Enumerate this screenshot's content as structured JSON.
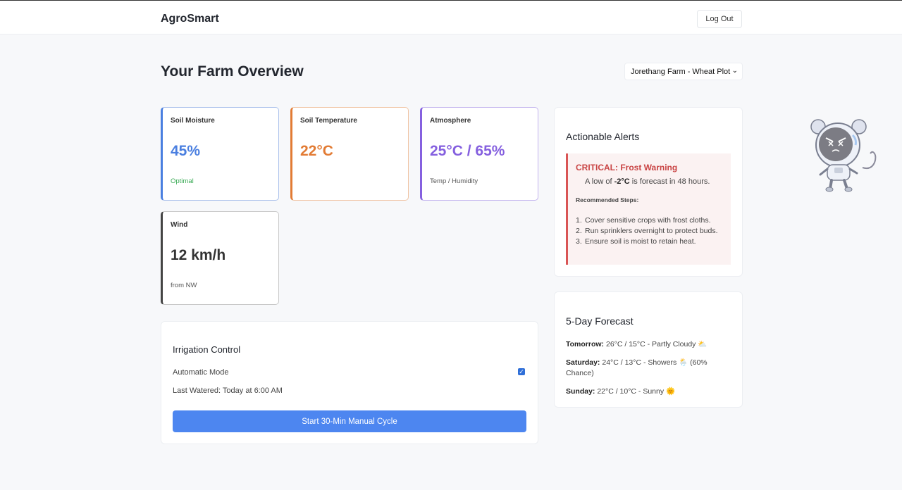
{
  "app": {
    "brand": "AgroSmart",
    "logout_label": "Log Out"
  },
  "page": {
    "title": "Your Farm Overview",
    "farm_selector": "Jorethang Farm - Wheat Plot"
  },
  "metrics": [
    {
      "label": "Soil Moisture",
      "value": "45%",
      "sub": "Optimal",
      "accent": "#4a7fe0"
    },
    {
      "label": "Soil Temperature",
      "value": "22°C",
      "sub": "",
      "accent": "#e27b34"
    },
    {
      "label": "Atmosphere",
      "value": "25°C / 65%",
      "sub": "Temp / Humidity",
      "accent": "#8560df"
    },
    {
      "label": "Wind",
      "value": "12 km/h",
      "sub": "from NW",
      "accent": "#444444"
    }
  ],
  "irrigation": {
    "title": "Irrigation Control",
    "auto_mode_label": "Automatic Mode",
    "auto_mode_checked": true,
    "last_watered": "Last Watered: Today at 6:00 AM",
    "manual_button": "Start 30-Min Manual Cycle"
  },
  "alerts": {
    "title": "Actionable Alerts",
    "alert_title": "CRITICAL: Frost Warning",
    "desc_prefix": "A low of ",
    "desc_value": "-2°C",
    "desc_suffix": " is forecast in 48 hours.",
    "steps_label": "Recommended Steps:",
    "steps": [
      {
        "num": "1.",
        "text": "Cover sensitive crops with frost cloths."
      },
      {
        "num": "2.",
        "text": "Run sprinklers overnight to protect buds."
      },
      {
        "num": "3.",
        "text": "Ensure soil is moist to retain heat."
      }
    ],
    "color": "#d95555"
  },
  "forecast": {
    "title": "5-Day Forecast",
    "days": [
      {
        "day": "Tomorrow:",
        "text": " 26°C / 15°C - Partly Cloudy ⛅"
      },
      {
        "day": "Saturday:",
        "text": " 24°C / 13°C - Showers 🌦️ (60% Chance)"
      },
      {
        "day": "Sunday:",
        "text": " 22°C / 10°C - Sunny 🌞"
      }
    ]
  },
  "icons": {
    "mascot": "astronaut-mouse-mascot-icon",
    "farm_select_chevron": "chevron-down-icon",
    "checkbox": "checkbox-checked-icon"
  }
}
